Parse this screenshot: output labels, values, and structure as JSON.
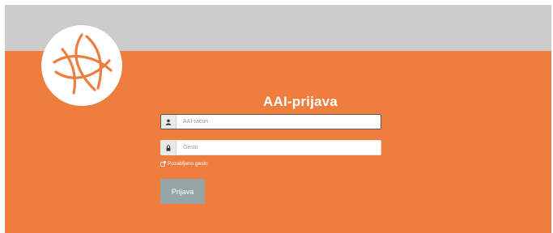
{
  "colors": {
    "background": "#ef7d3e",
    "header_bar": "#cccccc",
    "button": "#95a5a6",
    "text_on_orange": "#ffffff"
  },
  "logo": {
    "icon": "aai-swirl-logo-icon"
  },
  "form": {
    "title": "AAI-prijava",
    "username": {
      "placeholder": "AAI-račun",
      "value": "",
      "icon": "user-icon"
    },
    "password": {
      "placeholder": "Geslo",
      "value": "",
      "icon": "lock-icon"
    },
    "forgot_link": {
      "label": "Pozabljeno geslo",
      "icon": "external-link-icon"
    },
    "submit_label": "Prijava"
  }
}
